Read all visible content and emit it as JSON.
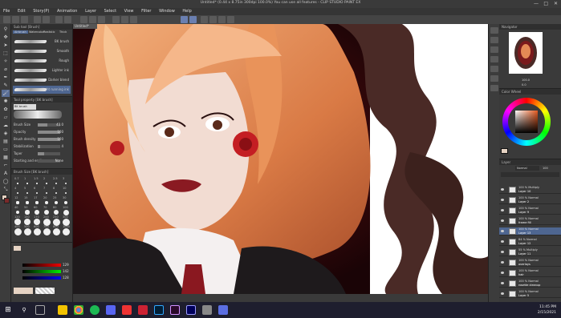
{
  "window": {
    "title": "Untitled* (0.44 x 8.75in 300dpi 100.0%) You can use all features - CLIP STUDIO PAINT EX",
    "controls": [
      "—",
      "□",
      "✕"
    ]
  },
  "menu": [
    "File",
    "Edit",
    "Story(P)",
    "Animation",
    "Layer",
    "Select",
    "View",
    "Filter",
    "Window",
    "Help"
  ],
  "canvas_tab": "Untitled*",
  "subtool": {
    "header": "Sub tool [Brush]",
    "tabs": [
      "Watercolor",
      "Realistic",
      "Thick"
    ],
    "active_tab": "Airbrush",
    "brushes": [
      {
        "label": "BK brush",
        "selected": false
      },
      {
        "label": "Smooth",
        "selected": false
      },
      {
        "label": "Rough",
        "selected": false
      },
      {
        "label": "Lighter ink",
        "selected": false
      },
      {
        "label": "Darker blend",
        "selected": false
      },
      {
        "label": "Light running ink",
        "selected": true
      }
    ]
  },
  "tool_property": {
    "header": "Tool property [BK brush]",
    "preset": "BK brush",
    "rows": [
      {
        "label": "Brush Size",
        "value": "43.0",
        "level": 0.43
      },
      {
        "label": "Opacity",
        "value": "100",
        "level": 1.0
      },
      {
        "label": "Brush density",
        "value": "100",
        "level": 1.0
      },
      {
        "label": "Stabilization",
        "value": "4",
        "level": 0.1
      },
      {
        "label": "Taper",
        "value": "",
        "level": 0.3
      },
      {
        "label": "Starting and ending",
        "value": "None",
        "level": 0
      }
    ]
  },
  "brush_size": {
    "header": "Brush Size [BK brush]",
    "sizes": [
      "0.7",
      "1",
      "1.5",
      "2",
      "2.5",
      "3",
      "4",
      "5",
      "6",
      "7",
      "8",
      "10",
      "12",
      "15",
      "17",
      "20",
      "25",
      "30",
      "40",
      "50",
      "60",
      "70",
      "80",
      "100",
      "120",
      "150",
      "170",
      "200",
      "250",
      "300",
      "400",
      "500",
      "600",
      "700",
      "800",
      "1000"
    ]
  },
  "color_slider": {
    "values": [
      "129",
      "142",
      "128"
    ]
  },
  "navigator": {
    "header": "Navigator",
    "zoom": "100.0",
    "angle": "0.0"
  },
  "color_wheel": {
    "header": "Color Wheel",
    "accent": "#e6d3c3"
  },
  "layers": {
    "header": "Layer",
    "blend": "Normal",
    "opacity": "100",
    "items": [
      {
        "mode": "100 % Multiply",
        "name": "Layer 10",
        "selected": false
      },
      {
        "mode": "100 % Normal",
        "name": "Layer 2",
        "selected": false
      },
      {
        "mode": "100 % Normal",
        "name": "Layer 9",
        "selected": false
      },
      {
        "mode": "100 % Normal",
        "name": "frame fill",
        "selected": false
      },
      {
        "mode": "100 % Normal",
        "name": "Layer 13",
        "selected": true
      },
      {
        "mode": "84 % Normal",
        "name": "Layer 12",
        "selected": false
      },
      {
        "mode": "55 % Multiply",
        "name": "Layer 11",
        "selected": false
      },
      {
        "mode": "100 % Normal",
        "name": "overlays",
        "selected": false
      },
      {
        "mode": "100 % Normal",
        "name": "hair",
        "selected": false
      },
      {
        "mode": "100 % Normal",
        "name": "rosette cleanup",
        "selected": false
      },
      {
        "mode": "100 % Normal",
        "name": "Layer 5",
        "selected": false
      }
    ]
  },
  "taskbar": {
    "time": "11:45 PM",
    "date": "2/15/2021"
  }
}
